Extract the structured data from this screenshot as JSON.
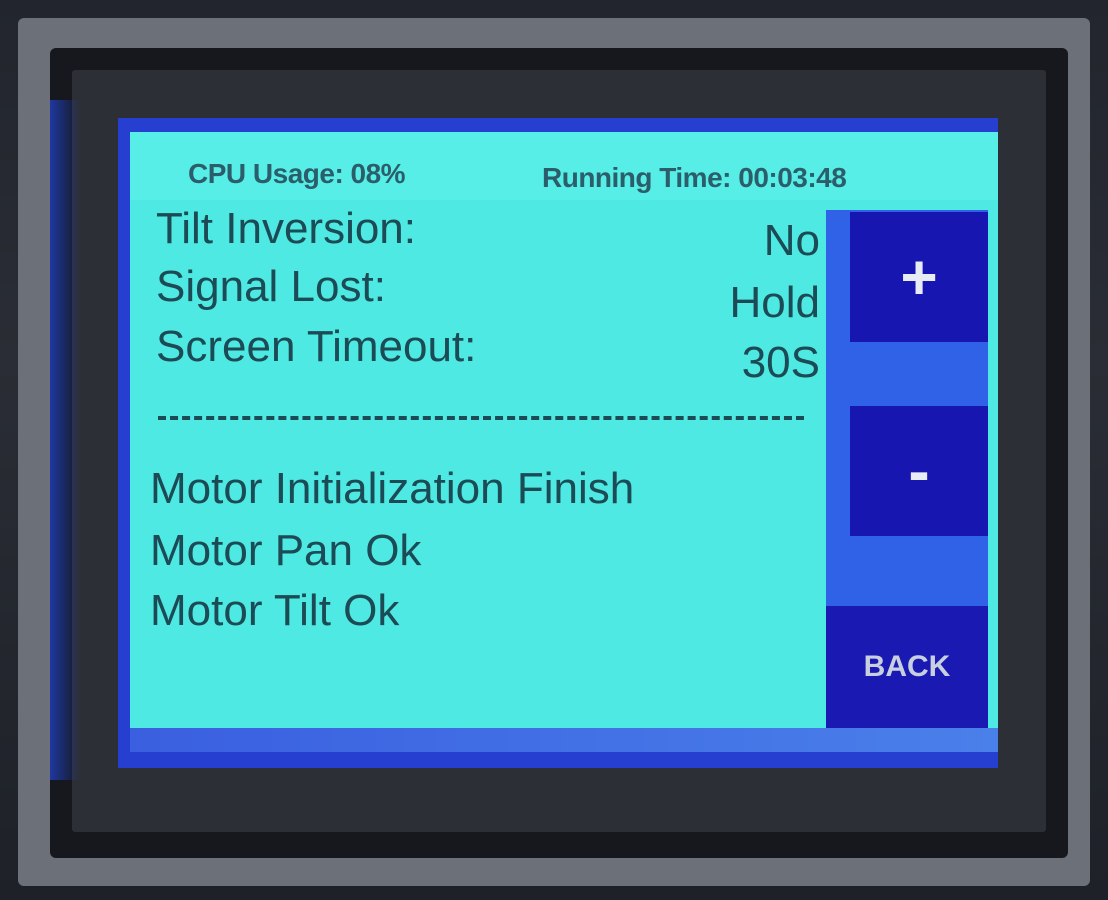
{
  "status_bar": {
    "cpu_usage": "CPU Usage: 08%",
    "running_time": "Running Time: 00:03:48"
  },
  "settings": [
    {
      "label": "Tilt Inversion:",
      "value": "No"
    },
    {
      "label": "Signal Lost:",
      "value": "Hold"
    },
    {
      "label": "Screen Timeout:",
      "value": "30S"
    }
  ],
  "status_messages": [
    "Motor Initialization Finish",
    "Motor Pan Ok",
    "Motor Tilt Ok"
  ],
  "buttons": {
    "increment": "+",
    "decrement": "-",
    "back": "BACK"
  },
  "colors": {
    "screen_background": "#4ee9e2",
    "button_background": "#1816b0",
    "button_column": "#2f62e6",
    "text": "#1c4a55"
  }
}
